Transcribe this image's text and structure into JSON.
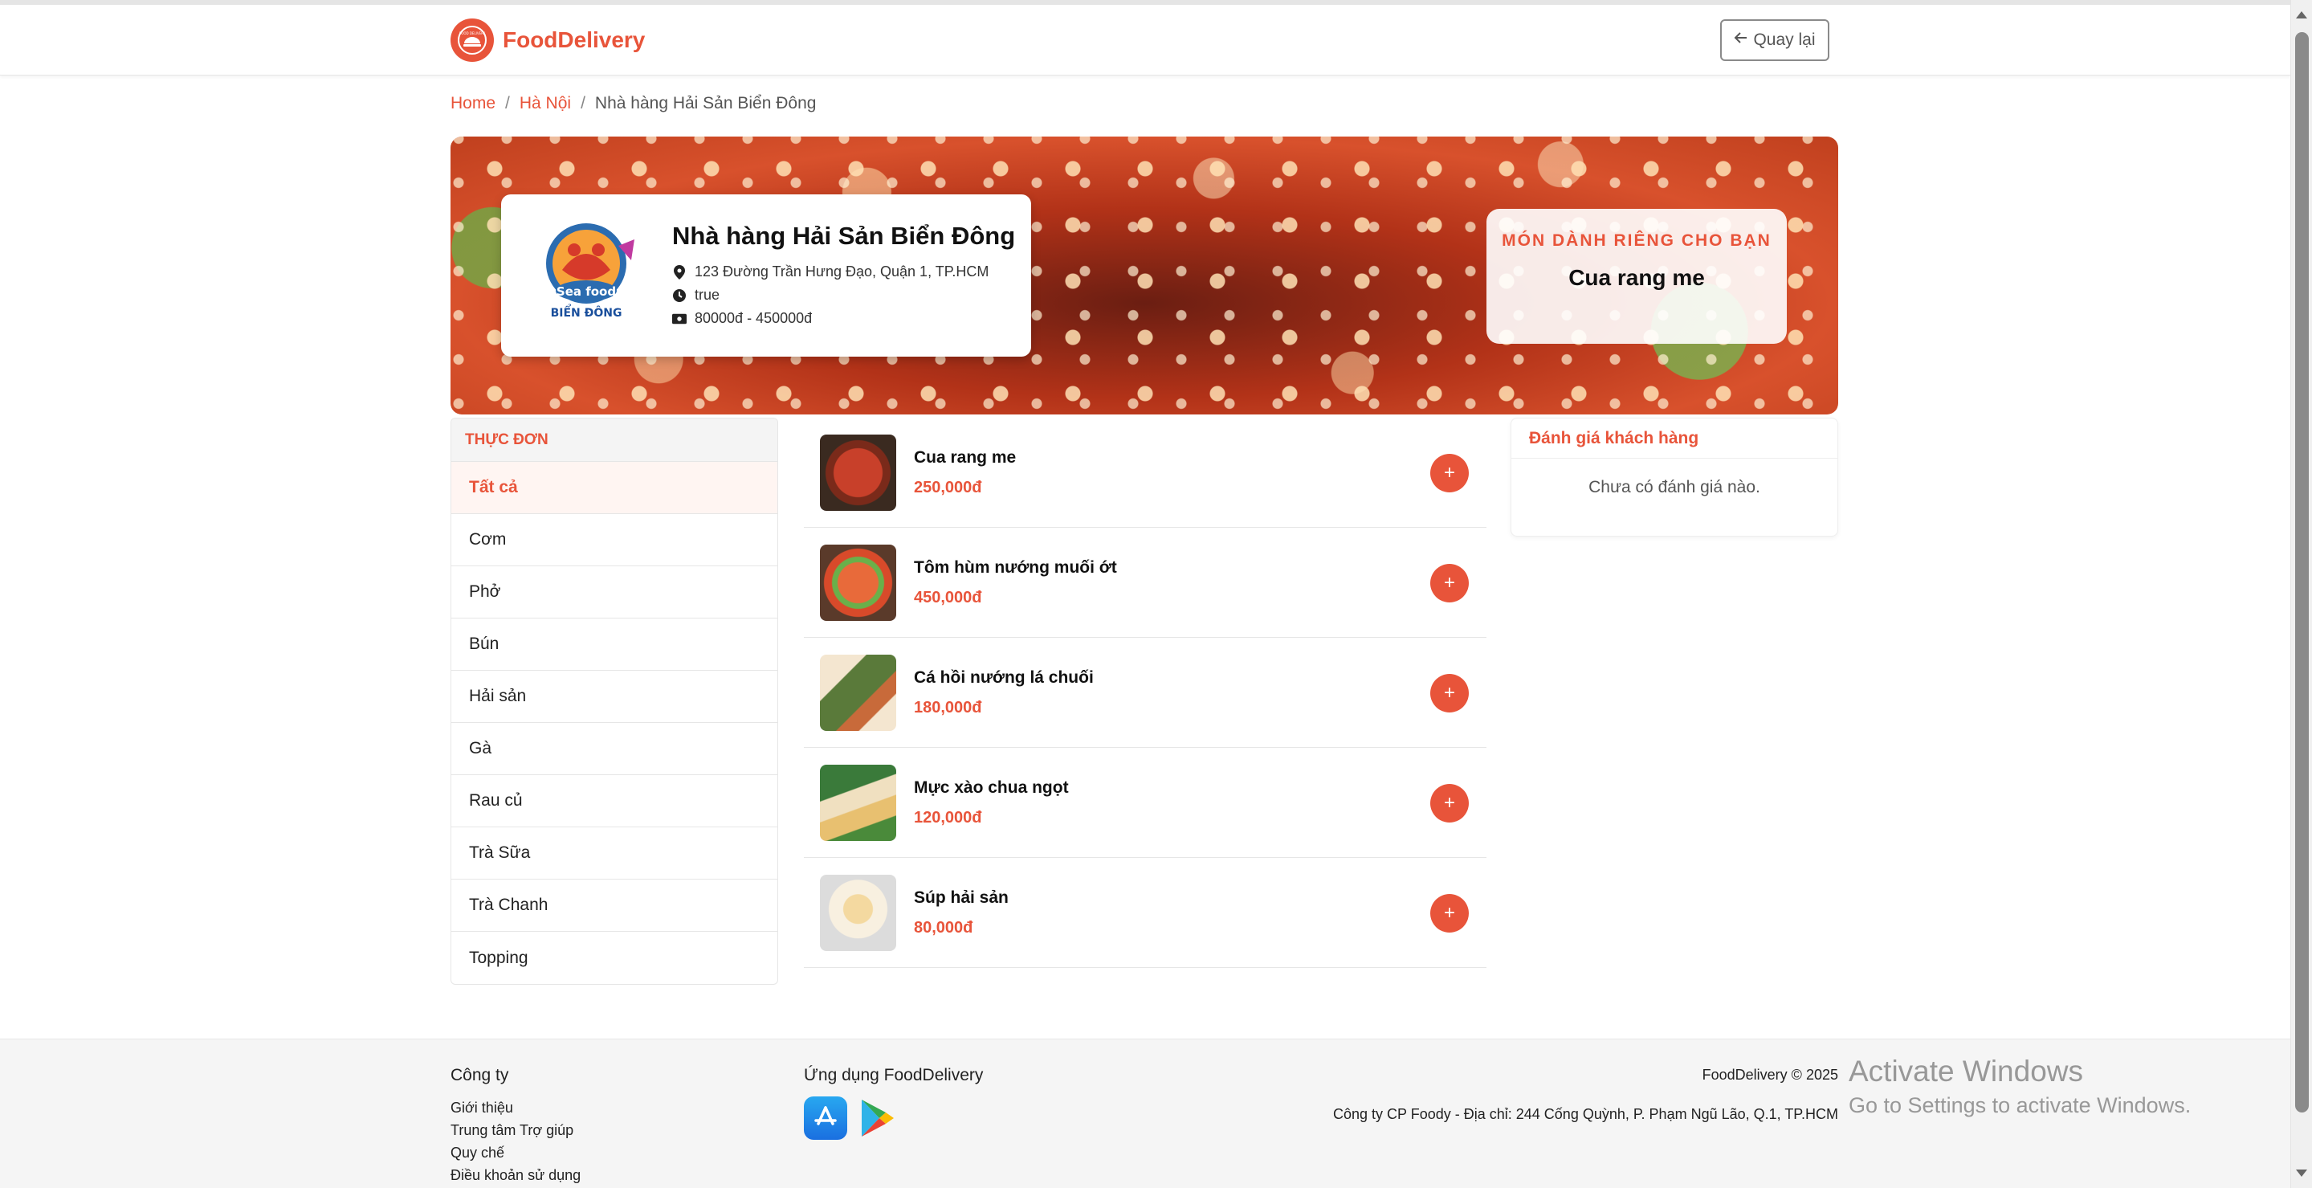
{
  "brand": {
    "name": "FoodDelivery",
    "logo_text": "FOOD DELIVERY"
  },
  "header": {
    "back_label": "Quay lại"
  },
  "breadcrumb": {
    "home": "Home",
    "city": "Hà Nội",
    "sep": "/",
    "current": "Nhà hàng Hải Sản Biển Đông"
  },
  "restaurant": {
    "logo_line1": "Sea food",
    "logo_line2": "BIỂN ĐÔNG",
    "name": "Nhà hàng Hải Sản Biển Đông",
    "address": "123 Đường Trần Hưng Đạo, Quận 1, TP.HCM",
    "hours": "true",
    "price_range": "80000đ - 450000đ"
  },
  "special": {
    "title": "MÓN DÀNH RIÊNG CHO BẠN",
    "dish": "Cua rang me"
  },
  "menu": {
    "heading": "THỰC ĐƠN",
    "items": [
      {
        "label": "Tất cả",
        "active": true
      },
      {
        "label": "Cơm"
      },
      {
        "label": "Phở"
      },
      {
        "label": "Bún"
      },
      {
        "label": "Hải sản"
      },
      {
        "label": "Gà"
      },
      {
        "label": "Rau củ"
      },
      {
        "label": "Trà Sữa"
      },
      {
        "label": "Trà Chanh"
      },
      {
        "label": "Topping"
      }
    ]
  },
  "dishes": [
    {
      "name": "Cua rang me",
      "price": "250,000đ",
      "add": "+"
    },
    {
      "name": "Tôm hùm nướng muối ớt",
      "price": "450,000đ",
      "add": "+"
    },
    {
      "name": "Cá hồi nướng lá chuối",
      "price": "180,000đ",
      "add": "+"
    },
    {
      "name": "Mực xào chua ngọt",
      "price": "120,000đ",
      "add": "+"
    },
    {
      "name": "Súp hải sản",
      "price": "80,000đ",
      "add": "+"
    }
  ],
  "reviews": {
    "title": "Đánh giá khách hàng",
    "empty": "Chưa có đánh giá nào."
  },
  "footer": {
    "company_title": "Công ty",
    "links": [
      "Giới thiệu",
      "Trung tâm Trợ giúp",
      "Quy chế",
      "Điều khoản sử dụng"
    ],
    "app_title": "Ứng dụng FoodDelivery",
    "copyright": "FoodDelivery © 2025",
    "address": "Công ty CP Foody - Địa chỉ: 244 Cống Quỳnh, P. Phạm Ngũ Lão, Q.1, TP.HCM"
  },
  "watermark": {
    "line1": "Activate Windows",
    "line2": "Go to Settings to activate Windows."
  },
  "colors": {
    "accent": "#e8543a",
    "text": "#222222",
    "footer_bg": "#f5f5f5"
  }
}
